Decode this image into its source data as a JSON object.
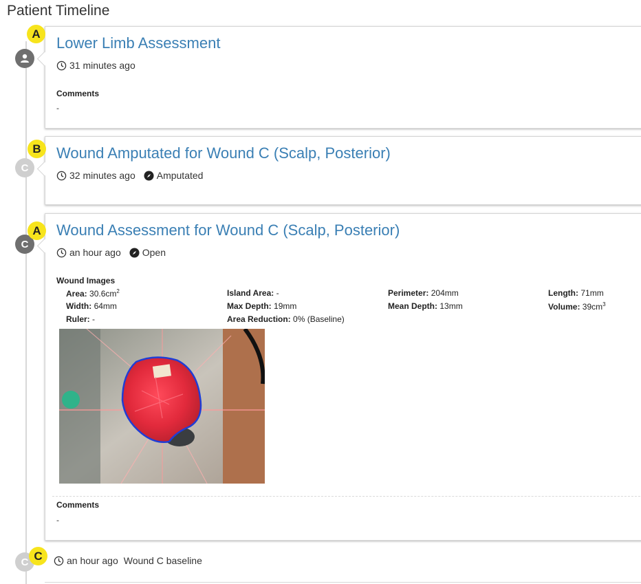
{
  "page_title": "Patient Timeline",
  "entries": [
    {
      "badge": "A",
      "title": "Lower Limb Assessment",
      "time": "31 minutes ago",
      "comments_label": "Comments",
      "comments_value": "-"
    },
    {
      "badge": "B",
      "node_letter": "C",
      "title": "Wound Amputated for Wound C (Scalp, Posterior)",
      "time": "32 minutes ago",
      "status": "Amputated"
    },
    {
      "badge": "A",
      "node_letter": "C",
      "title": "Wound Assessment for Wound C (Scalp, Posterior)",
      "time": "an hour ago",
      "status": "Open",
      "section_label": "Wound Images",
      "metrics": {
        "area_label": "Area:",
        "area_value": "30.6cm",
        "area_sup": "2",
        "island_label": "Island Area:",
        "island_value": "-",
        "perimeter_label": "Perimeter:",
        "perimeter_value": "204mm",
        "length_label": "Length:",
        "length_value": "71mm",
        "width_label": "Width:",
        "width_value": "64mm",
        "maxdepth_label": "Max Depth:",
        "maxdepth_value": "19mm",
        "meandepth_label": "Mean Depth:",
        "meandepth_value": "13mm",
        "volume_label": "Volume:",
        "volume_value": "39cm",
        "volume_sup": "3",
        "ruler_label": "Ruler:",
        "ruler_value": "-",
        "reduction_label": "Area Reduction:",
        "reduction_value": "0% (Baseline)"
      },
      "comments_label": "Comments",
      "comments_value": "-"
    },
    {
      "badge": "C",
      "node_letter": "C",
      "time": "an hour ago",
      "text": "Wound C baseline"
    }
  ],
  "colors": {
    "link": "#3a7fb4",
    "badge": "#f7e41c",
    "node_dark": "#6f6f6f",
    "node_light": "#cfcfcf",
    "wound_outline": "#1f3dd6"
  },
  "icons": {
    "clock": "clock-icon",
    "status": "compass-icon",
    "user": "user-icon"
  }
}
